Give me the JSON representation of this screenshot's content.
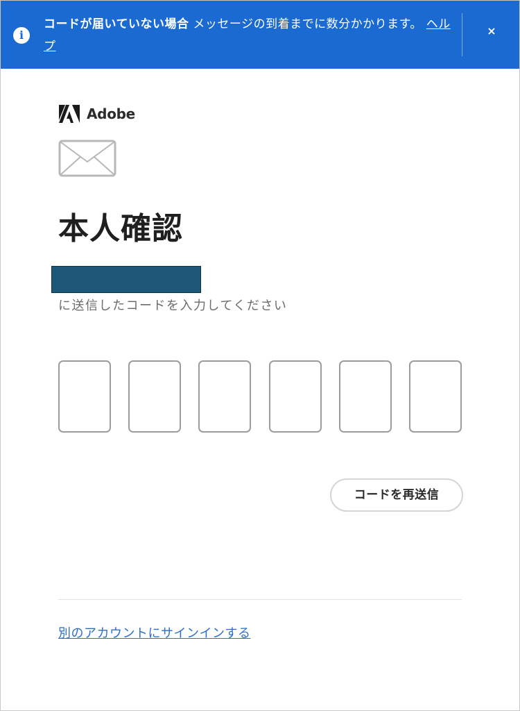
{
  "banner": {
    "bold_text": "コードが届いていない場合",
    "message": " メッセージの到着までに数分かかります。",
    "help_link": "ヘルプ",
    "close_label": "×",
    "info_glyph": "i",
    "background_color": "#1b6ad1"
  },
  "brand": {
    "name": "Adobe"
  },
  "main": {
    "title": "本人確認",
    "instruction": "に送信したコードを入力してください",
    "code_digits": [
      "",
      "",
      "",
      "",
      "",
      ""
    ],
    "resend_label": "コードを再送信"
  },
  "footer": {
    "switch_account_label": "別のアカウントにサインインする",
    "link_color": "#2d6fc8"
  },
  "icons": {
    "banner": "info-icon",
    "close": "close-icon",
    "logo": "adobe-logo-icon",
    "mail": "mail-envelope-icon"
  }
}
